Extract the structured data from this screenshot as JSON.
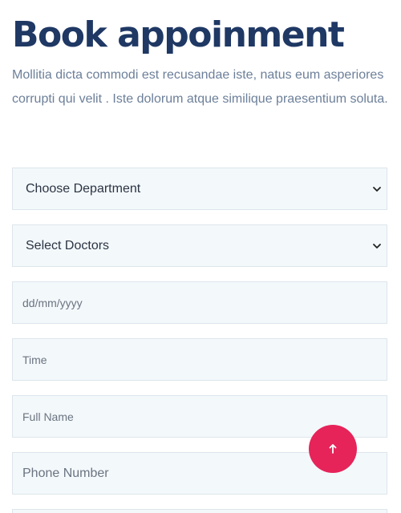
{
  "heading": "Book appoinment",
  "description": "Mollitia dicta commodi est recusandae iste, natus eum asperiores corrupti qui velit . Iste dolorum atque similique praesentium soluta.",
  "form": {
    "department_select": "Choose Department",
    "doctor_select": "Select Doctors",
    "date_placeholder": "dd/mm/yyyy",
    "time_placeholder": "Time",
    "name_placeholder": "Full Name",
    "phone_placeholder": "Phone Number"
  },
  "icons": {
    "select_arrow": "chevron-down-icon",
    "scroll_top": "arrow-up-icon"
  },
  "colors": {
    "heading": "#1f3864",
    "accent": "#e6245a",
    "field_bg": "#f3f8fb"
  }
}
